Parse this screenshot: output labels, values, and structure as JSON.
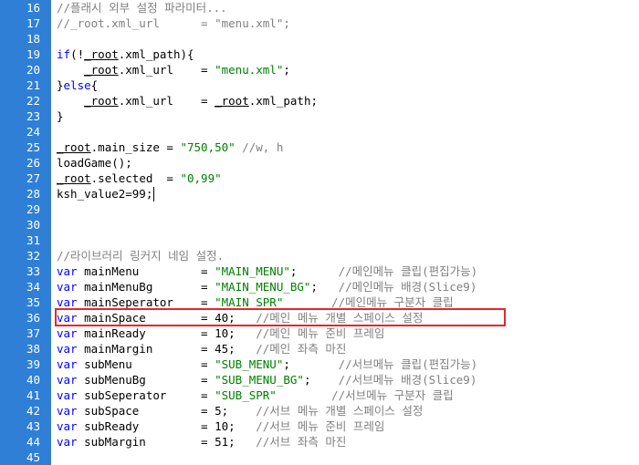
{
  "colors": {
    "gutter": "#2f7fd6",
    "keyword": "#0000ff",
    "string": "#008000",
    "comment": "#808080",
    "highlight_border": "#e8262a"
  },
  "editor": {
    "lines": [
      {
        "num": "16",
        "parts": [
          {
            "t": "cm",
            "v": "//플래시 외부 설정 파라미터..."
          }
        ]
      },
      {
        "num": "17",
        "parts": [
          {
            "t": "cm",
            "v": "//_root.xml_url      = \"menu.xml\";"
          }
        ]
      },
      {
        "num": "18",
        "parts": []
      },
      {
        "num": "19",
        "parts": [
          {
            "t": "kw",
            "v": "if"
          },
          {
            "t": "pl",
            "v": "(!"
          },
          {
            "t": "ul",
            "v": "_root"
          },
          {
            "t": "pl",
            "v": ".xml_path){"
          }
        ]
      },
      {
        "num": "20",
        "parts": [
          {
            "t": "pl",
            "v": "    "
          },
          {
            "t": "ul",
            "v": "_root"
          },
          {
            "t": "pl",
            "v": ".xml_url    = "
          },
          {
            "t": "str",
            "v": "\"menu.xml\""
          },
          {
            "t": "pl",
            "v": ";"
          }
        ]
      },
      {
        "num": "21",
        "parts": [
          {
            "t": "pl",
            "v": "}"
          },
          {
            "t": "kw",
            "v": "else"
          },
          {
            "t": "pl",
            "v": "{"
          }
        ]
      },
      {
        "num": "22",
        "parts": [
          {
            "t": "pl",
            "v": "    "
          },
          {
            "t": "ul",
            "v": "_root"
          },
          {
            "t": "pl",
            "v": ".xml_url    = "
          },
          {
            "t": "ul",
            "v": "_root"
          },
          {
            "t": "pl",
            "v": ".xml_path;"
          }
        ]
      },
      {
        "num": "23",
        "parts": [
          {
            "t": "pl",
            "v": "}"
          }
        ]
      },
      {
        "num": "24",
        "parts": []
      },
      {
        "num": "25",
        "parts": [
          {
            "t": "ul",
            "v": "_root"
          },
          {
            "t": "pl",
            "v": ".main_size = "
          },
          {
            "t": "str",
            "v": "\"750,50\""
          },
          {
            "t": "pl",
            "v": " "
          },
          {
            "t": "cm",
            "v": "//w, h"
          }
        ]
      },
      {
        "num": "26",
        "parts": [
          {
            "t": "pl",
            "v": "loadGame();"
          }
        ]
      },
      {
        "num": "27",
        "parts": [
          {
            "t": "ul",
            "v": "_root"
          },
          {
            "t": "pl",
            "v": ".selected  = "
          },
          {
            "t": "str",
            "v": "\"0,99\""
          }
        ]
      },
      {
        "num": "28",
        "parts": [
          {
            "t": "pl",
            "v": "ksh_value2=99;"
          }
        ]
      },
      {
        "num": "29",
        "parts": []
      },
      {
        "num": "30",
        "parts": []
      },
      {
        "num": "31",
        "parts": []
      },
      {
        "num": "32",
        "parts": [
          {
            "t": "cm",
            "v": "//라이브러리 링커지 네임 설정."
          }
        ]
      },
      {
        "num": "33",
        "parts": [
          {
            "t": "kw",
            "v": "var"
          },
          {
            "t": "pl",
            "v": " mainMenu         = "
          },
          {
            "t": "str",
            "v": "\"MAIN_MENU\""
          },
          {
            "t": "pl",
            "v": ";      "
          },
          {
            "t": "cm",
            "v": "//메인메뉴 클립(편집가능)"
          }
        ]
      },
      {
        "num": "34",
        "parts": [
          {
            "t": "kw",
            "v": "var"
          },
          {
            "t": "pl",
            "v": " mainMenuBg       = "
          },
          {
            "t": "str",
            "v": "\"MAIN_MENU_BG\""
          },
          {
            "t": "pl",
            "v": ";   "
          },
          {
            "t": "cm",
            "v": "//메인메뉴 배경(Slice9)"
          }
        ]
      },
      {
        "num": "35",
        "parts": [
          {
            "t": "kw",
            "v": "var"
          },
          {
            "t": "pl",
            "v": " mainSeperator    = "
          },
          {
            "t": "str",
            "v": "\"MAIN_SPR\""
          },
          {
            "t": "pl",
            "v": "       "
          },
          {
            "t": "cm",
            "v": "//메인메뉴 구분자 클립"
          }
        ]
      },
      {
        "num": "36",
        "parts": [
          {
            "t": "kw",
            "v": "var"
          },
          {
            "t": "pl",
            "v": " mainSpace        = 40;   "
          },
          {
            "t": "cm",
            "v": "//메인 메뉴 개별 스페이스 설정"
          }
        ]
      },
      {
        "num": "37",
        "parts": [
          {
            "t": "kw",
            "v": "var"
          },
          {
            "t": "pl",
            "v": " mainReady        = 10;   "
          },
          {
            "t": "cm",
            "v": "//메인 메뉴 준비 프레임"
          }
        ]
      },
      {
        "num": "38",
        "parts": [
          {
            "t": "kw",
            "v": "var"
          },
          {
            "t": "pl",
            "v": " mainMargin       = 45;   "
          },
          {
            "t": "cm",
            "v": "//메인 좌측 마진"
          }
        ]
      },
      {
        "num": "39",
        "parts": [
          {
            "t": "kw",
            "v": "var"
          },
          {
            "t": "pl",
            "v": " subMenu          = "
          },
          {
            "t": "str",
            "v": "\"SUB_MENU\""
          },
          {
            "t": "pl",
            "v": ";       "
          },
          {
            "t": "cm",
            "v": "//서브메뉴 클립(편집가능)"
          }
        ]
      },
      {
        "num": "40",
        "parts": [
          {
            "t": "kw",
            "v": "var"
          },
          {
            "t": "pl",
            "v": " subMenuBg        = "
          },
          {
            "t": "str",
            "v": "\"SUB_MENU_BG\""
          },
          {
            "t": "pl",
            "v": ";    "
          },
          {
            "t": "cm",
            "v": "//서브메뉴 배경(Slice9)"
          }
        ]
      },
      {
        "num": "41",
        "parts": [
          {
            "t": "kw",
            "v": "var"
          },
          {
            "t": "pl",
            "v": " subSeperator     = "
          },
          {
            "t": "str",
            "v": "\"SUB_SPR\""
          },
          {
            "t": "pl",
            "v": "        "
          },
          {
            "t": "cm",
            "v": "//서브메뉴 구분자 클립"
          }
        ]
      },
      {
        "num": "42",
        "parts": [
          {
            "t": "kw",
            "v": "var"
          },
          {
            "t": "pl",
            "v": " subSpace         = 5;    "
          },
          {
            "t": "cm",
            "v": "//서브 메뉴 개별 스페이스 설정"
          }
        ]
      },
      {
        "num": "43",
        "parts": [
          {
            "t": "kw",
            "v": "var"
          },
          {
            "t": "pl",
            "v": " subReady         = 10;   "
          },
          {
            "t": "cm",
            "v": "//서브 메뉴 준비 프레임"
          }
        ]
      },
      {
        "num": "44",
        "parts": [
          {
            "t": "kw",
            "v": "var"
          },
          {
            "t": "pl",
            "v": " subMargin        = 51;   "
          },
          {
            "t": "cm",
            "v": "//서브 좌측 마진"
          }
        ]
      },
      {
        "num": "45",
        "parts": []
      }
    ]
  }
}
